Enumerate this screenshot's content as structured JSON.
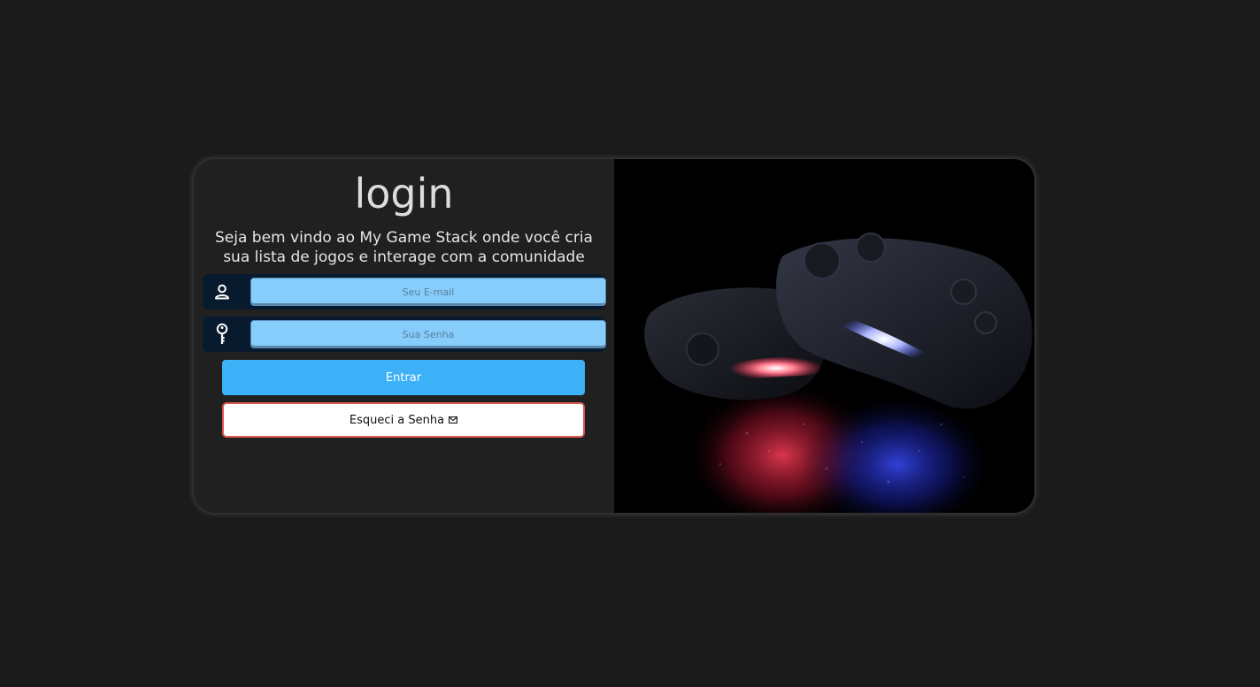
{
  "login": {
    "title": "login",
    "subtitle": "Seja bem vindo ao My Game Stack onde você cria sua lista de jogos e interage com a comunidade",
    "email": {
      "placeholder": "Seu E-mail",
      "value": "",
      "icon": "user-icon"
    },
    "password": {
      "placeholder": "Sua Senha",
      "value": "",
      "icon": "key-icon"
    },
    "enter_label": "Entrar",
    "forgot_label": "Esqueci a Senha",
    "forgot_icon": "mail-icon"
  },
  "colors": {
    "page_background": "#1b1b1b",
    "card_background": "#202020",
    "input_background": "#87cdfc",
    "field_background": "#081a2e",
    "primary_button": "#3cb1f7",
    "forgot_border": "#e05858"
  },
  "hero_image": {
    "subject": "game-controllers-image"
  }
}
